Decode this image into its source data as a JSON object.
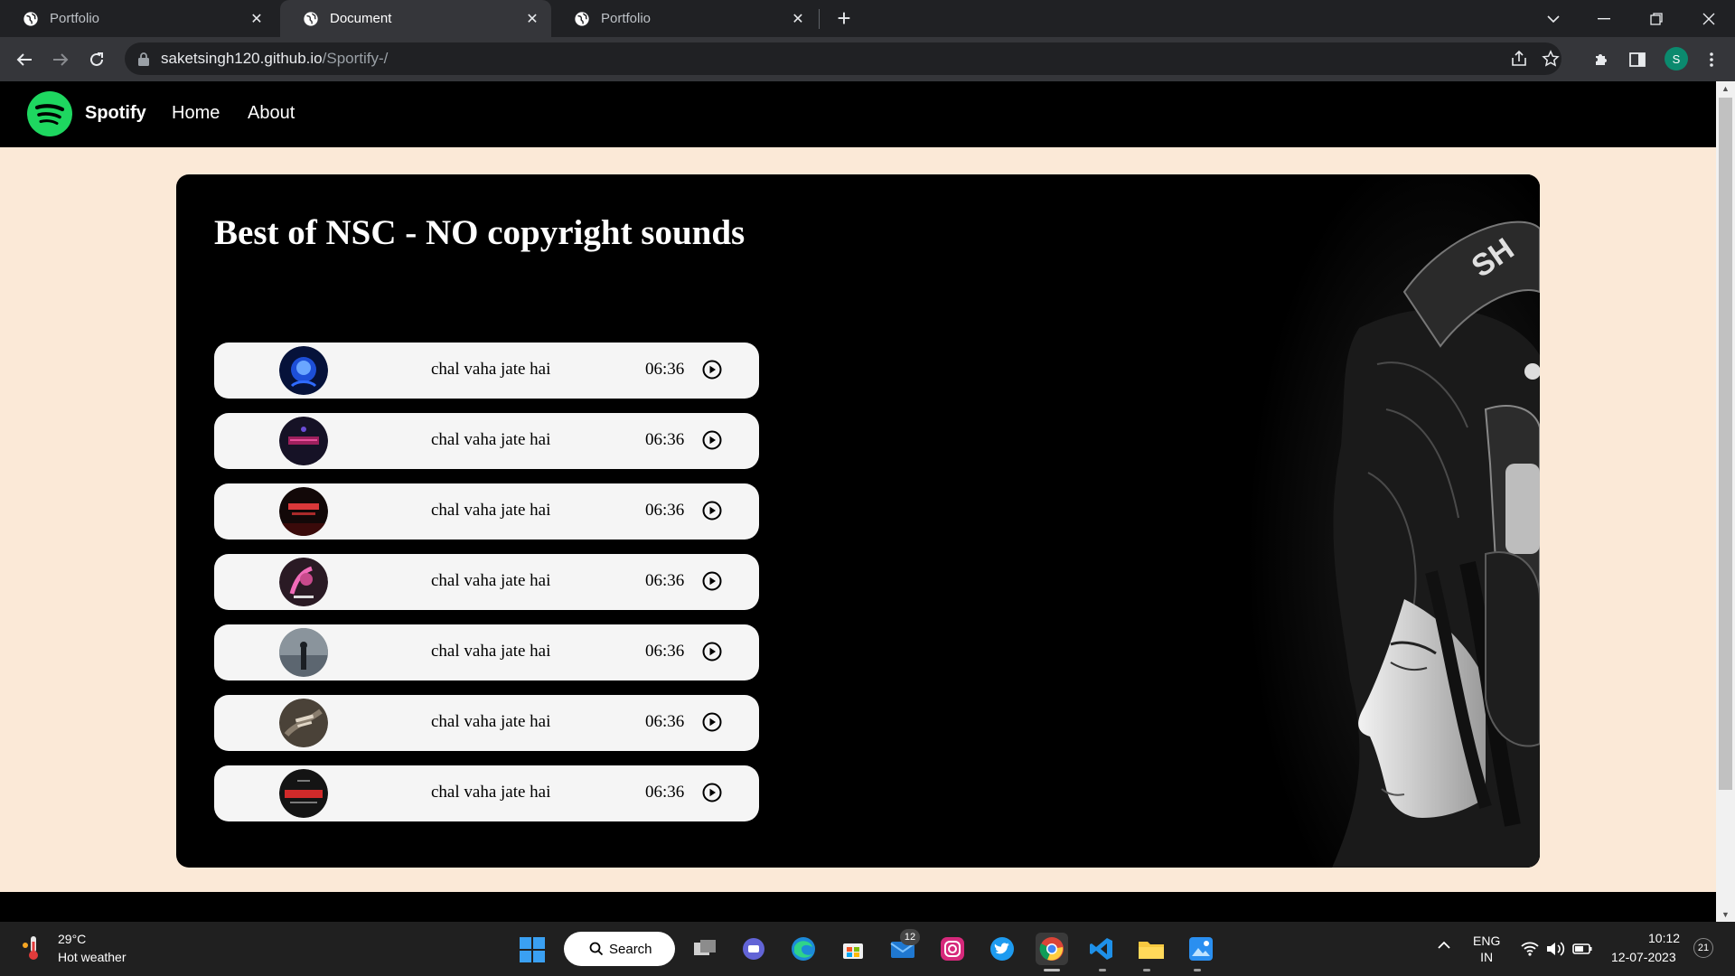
{
  "browser": {
    "tabs": [
      {
        "title": "Portfolio",
        "active": false
      },
      {
        "title": "Document",
        "active": true
      },
      {
        "title": "Portfolio",
        "active": false
      }
    ],
    "url_host": "saketsingh120.github.io",
    "url_path": "/Sportify-/",
    "profile_initial": "S"
  },
  "site": {
    "brand": "Spotify",
    "brand_color": "#1ed760",
    "nav": [
      "Home",
      "About"
    ],
    "page_background": "#fbe9d7"
  },
  "playlist": {
    "title": "Best of NSC - NO copyright sounds",
    "songs": [
      {
        "name": "chal vaha jate hai",
        "duration": "06:36",
        "cover": "blue-face-cover"
      },
      {
        "name": "chal vaha jate hai",
        "duration": "06:36",
        "cover": "purple-neon-cover"
      },
      {
        "name": "chal vaha jate hai",
        "duration": "06:36",
        "cover": "red-text-cover"
      },
      {
        "name": "chal vaha jate hai",
        "duration": "06:36",
        "cover": "pink-art-cover"
      },
      {
        "name": "chal vaha jate hai",
        "duration": "06:36",
        "cover": "grey-figure-cover"
      },
      {
        "name": "chal vaha jate hai",
        "duration": "06:36",
        "cover": "sepia-dance-cover"
      },
      {
        "name": "chal vaha jate hai",
        "duration": "06:36",
        "cover": "back-it-up-cover"
      }
    ]
  },
  "taskbar": {
    "weather_temp": "29°C",
    "weather_desc": "Hot weather",
    "search_label": "Search",
    "mail_badge": "12",
    "lang_line1": "ENG",
    "lang_line2": "IN",
    "time": "10:12",
    "date": "12-07-2023",
    "notifications": "21"
  }
}
